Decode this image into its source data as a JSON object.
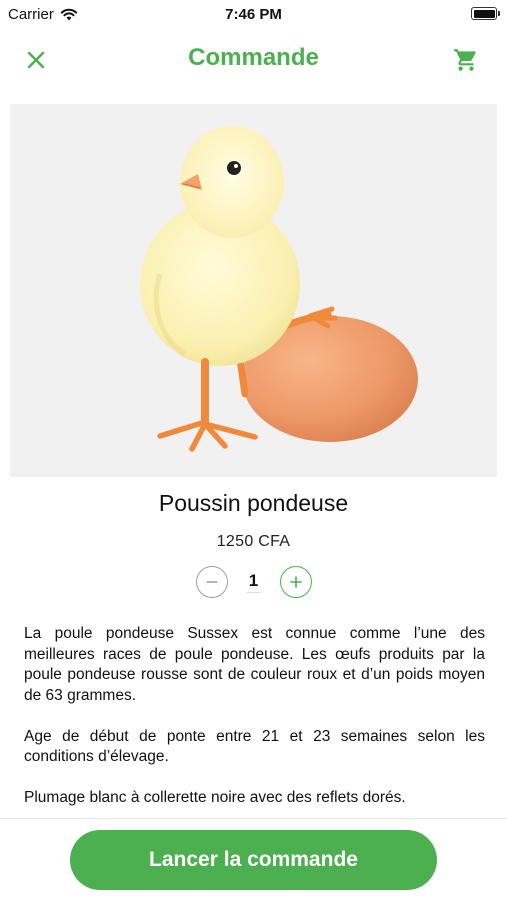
{
  "status_bar": {
    "carrier": "Carrier",
    "time": "7:46 PM",
    "battery_level": 1.0
  },
  "nav": {
    "title": "Commande",
    "close_icon": "close-icon",
    "cart_icon": "shopping-cart-icon"
  },
  "product": {
    "image_subject": "yellow chick standing beside a brown egg",
    "name": "Poussin pondeuse",
    "price": "1250 CFA",
    "quantity": "1",
    "description": [
      "La poule pondeuse Sussex est connue comme l’une des meilleures races de poule pondeuse. Les œufs produits par la poule pondeuse rousse sont de couleur roux et d’un poids moyen de 63 grammes.",
      "Age de début de ponte entre 21 et 23 semaines selon les conditions d’élevage.",
      "Plumage blanc à collerette noire avec des reflets dorés."
    ]
  },
  "actions": {
    "order_label": "Lancer la commande"
  },
  "colors": {
    "accent": "#4caf50",
    "disabled": "#9e9e9e",
    "image_background": "#f1f1f1"
  }
}
